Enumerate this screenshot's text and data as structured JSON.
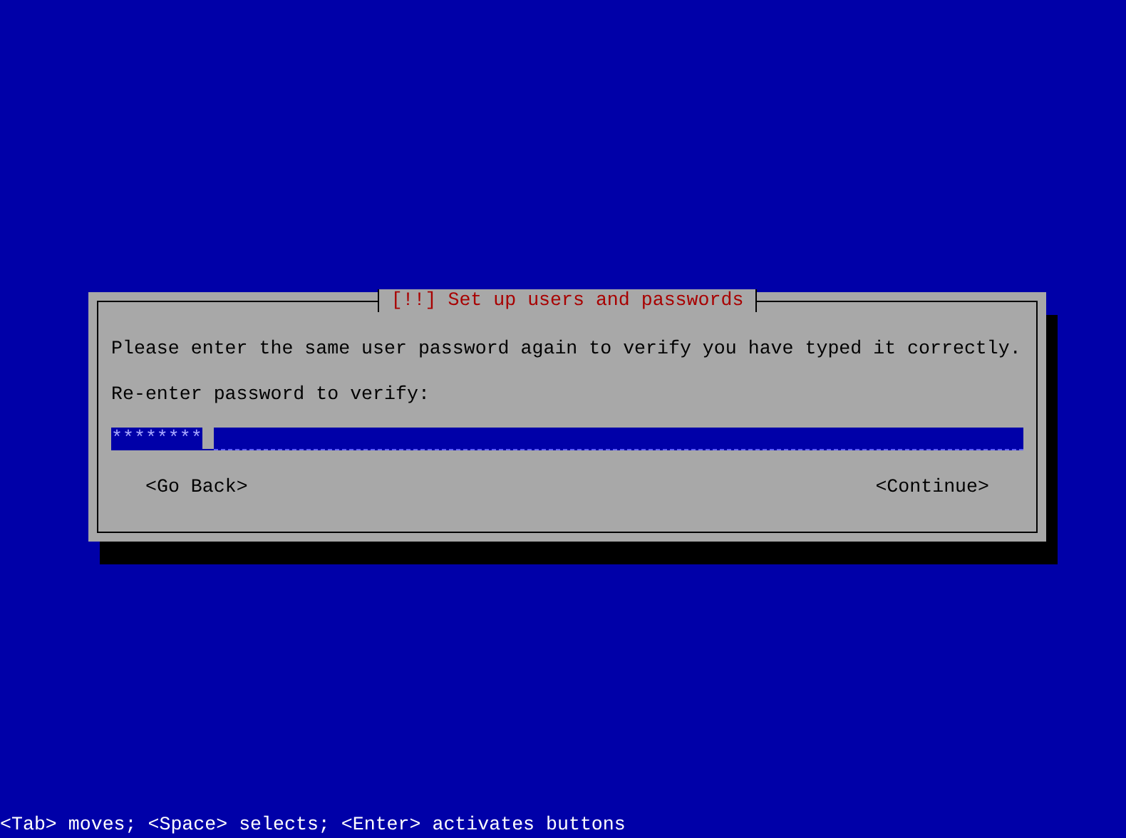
{
  "dialog": {
    "title": "[!!] Set up users and passwords",
    "message": "Please enter the same user password again to verify you have typed it correctly.",
    "field_label": "Re-enter password to verify:",
    "password_field": {
      "value": "********"
    },
    "buttons": [
      {
        "label": "<Go Back>",
        "selected": false
      },
      {
        "label": "<Continue>",
        "selected": false
      }
    ]
  },
  "status_bar": "<Tab> moves; <Space> selects; <Enter> activates buttons"
}
